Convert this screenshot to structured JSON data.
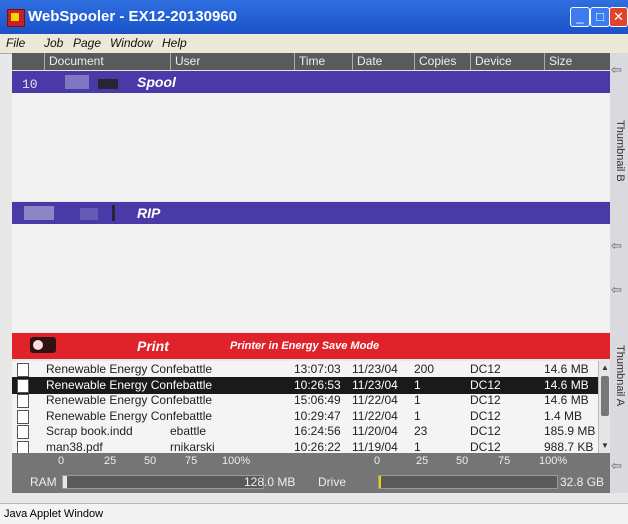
{
  "window": {
    "title": "WebSpooler - EX12-20130960"
  },
  "menu": [
    "File",
    "Job",
    "Page",
    "Window",
    "Help"
  ],
  "columns": [
    "Document",
    "User",
    "Time",
    "Date",
    "Copies",
    "Device",
    "Size"
  ],
  "bands": {
    "spool": "Spool",
    "rip": "RIP",
    "print": "Print",
    "print_status": "Printer in Energy Save Mode"
  },
  "side_labels": [
    "Thumbnail B",
    "Thumbnail A"
  ],
  "jobs": [
    {
      "doc": "Renewable Energy Confebattle",
      "user": "",
      "time": "13:07:03",
      "date": "11/23/04",
      "copies": "200",
      "device": "DC12",
      "size": "14.6 MB",
      "selected": false
    },
    {
      "doc": "Renewable Energy Confebattle",
      "user": "",
      "time": "10:26:53",
      "date": "11/23/04",
      "copies": "1",
      "device": "DC12",
      "size": "14.6 MB",
      "selected": true
    },
    {
      "doc": "Renewable Energy Confebattle",
      "user": "",
      "time": "15:06:49",
      "date": "11/22/04",
      "copies": "1",
      "device": "DC12",
      "size": "14.6 MB",
      "selected": false
    },
    {
      "doc": "Renewable Energy Confebattle",
      "user": "",
      "time": "10:29:47",
      "date": "11/22/04",
      "copies": "1",
      "device": "DC12",
      "size": "1.4 MB",
      "selected": false
    },
    {
      "doc": "Scrap book.indd",
      "user": "ebattle",
      "time": "16:24:56",
      "date": "11/20/04",
      "copies": "23",
      "device": "DC12",
      "size": "185.9 MB",
      "selected": false
    },
    {
      "doc": "man38.pdf",
      "user": "rnikarski",
      "time": "10:26:22",
      "date": "11/19/04",
      "copies": "1",
      "device": "DC12",
      "size": "988.7 KB",
      "selected": false
    }
  ],
  "meters": {
    "ticks": [
      "0",
      "25",
      "50",
      "75",
      "100%"
    ],
    "ram": {
      "label": "RAM",
      "value": "128.0 MB",
      "fill_pct": 2
    },
    "drive": {
      "label": "Drive",
      "value": "32.8 GB",
      "fill_pct": 1
    }
  },
  "status": "Java Applet Window",
  "colors": {
    "spool_band": "#4a3aa8",
    "rip_band": "#4a3aa8",
    "print_band": "#e0222a",
    "titlebar": "#2563d6",
    "selected_row": "#1a1a1a"
  }
}
